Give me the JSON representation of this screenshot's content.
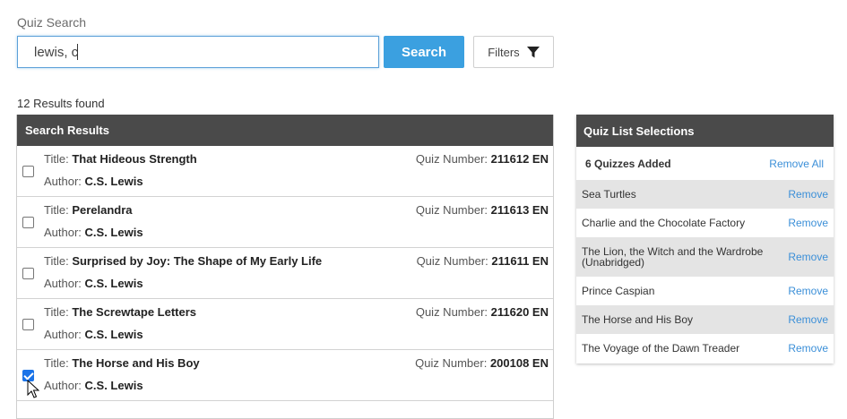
{
  "search": {
    "label": "Quiz Search",
    "value": "lewis, c",
    "button_label": "Search",
    "filters_label": "Filters"
  },
  "results": {
    "count_text": "12 Results found",
    "header": "Search Results",
    "title_prefix": "Title: ",
    "author_prefix": "Author: ",
    "quiz_prefix": "Quiz Number: ",
    "rows": [
      {
        "title": "That Hideous Strength",
        "author": "C.S. Lewis",
        "quiz": "211612 EN",
        "checked": false
      },
      {
        "title": "Perelandra",
        "author": "C.S. Lewis",
        "quiz": "211613 EN",
        "checked": false
      },
      {
        "title": "Surprised by Joy: The Shape of My Early Life",
        "author": "C.S. Lewis",
        "quiz": "211611 EN",
        "checked": false
      },
      {
        "title": "The Screwtape Letters",
        "author": "C.S. Lewis",
        "quiz": "211620 EN",
        "checked": false
      },
      {
        "title": "The Horse and His Boy",
        "author": "C.S. Lewis",
        "quiz": "200108 EN",
        "checked": true
      }
    ]
  },
  "quiz_list": {
    "header": "Quiz List Selections",
    "added_text": "6 Quizzes Added",
    "remove_all": "Remove All",
    "remove_label": "Remove",
    "items": [
      {
        "name": "Sea Turtles",
        "shaded": true
      },
      {
        "name": "Charlie and the Chocolate Factory",
        "shaded": false
      },
      {
        "name": "The Lion, the Witch and the Wardrobe (Unabridged)",
        "shaded": true
      },
      {
        "name": "Prince Caspian",
        "shaded": false
      },
      {
        "name": "The Horse and His Boy",
        "shaded": true
      },
      {
        "name": "The Voyage of the Dawn Treader",
        "shaded": false
      }
    ]
  },
  "colors": {
    "accent": "#3ba0e0",
    "header_bg": "#4a4a4a",
    "link": "#3b8fd8"
  },
  "icons": {
    "filters": "filter-funnel-icon",
    "cursor": "mouse-pointer-icon"
  }
}
